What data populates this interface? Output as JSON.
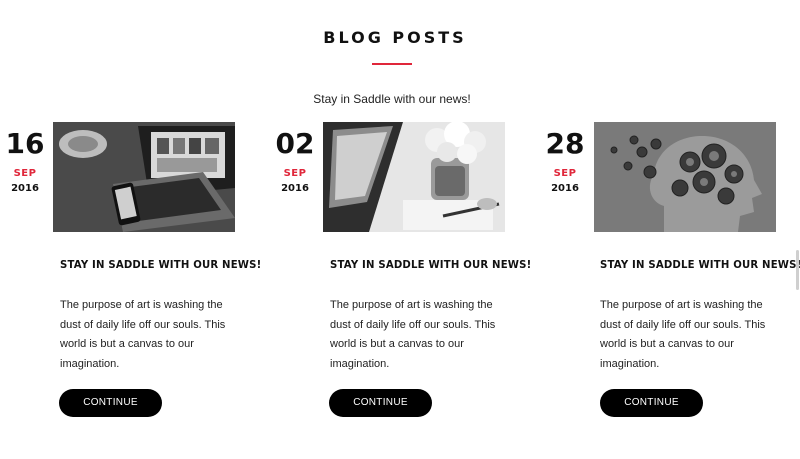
{
  "header": {
    "title": "BLOG POSTS",
    "subtitle": "Stay in Saddle with our news!"
  },
  "colors": {
    "accent": "#e0263a",
    "button": "#000000"
  },
  "posts": [
    {
      "day": "16",
      "month": "SEP",
      "year": "2016",
      "image": "laptop-photo-image",
      "title": "STAY IN SADDLE WITH OUR NEWS!",
      "excerpt": "The purpose of art is washing the dust of daily life off our souls. This world is but a canvas to our imagination.",
      "button": "CONTINUE"
    },
    {
      "day": "02",
      "month": "SEP",
      "year": "2016",
      "image": "desk-flowers-image",
      "title": "STAY IN SADDLE WITH OUR NEWS!",
      "excerpt": "The purpose of art is washing the dust of daily life off our souls. This world is but a canvas to our imagination.",
      "button": "CONTINUE"
    },
    {
      "day": "28",
      "month": "SEP",
      "year": "2016",
      "image": "gears-head-image",
      "title": "STAY IN SADDLE WITH OUR NEWS!",
      "excerpt": "The purpose of art is washing the dust of daily life off our souls. This world is but a canvas to our imagination.",
      "button": "CONTINUE"
    }
  ]
}
